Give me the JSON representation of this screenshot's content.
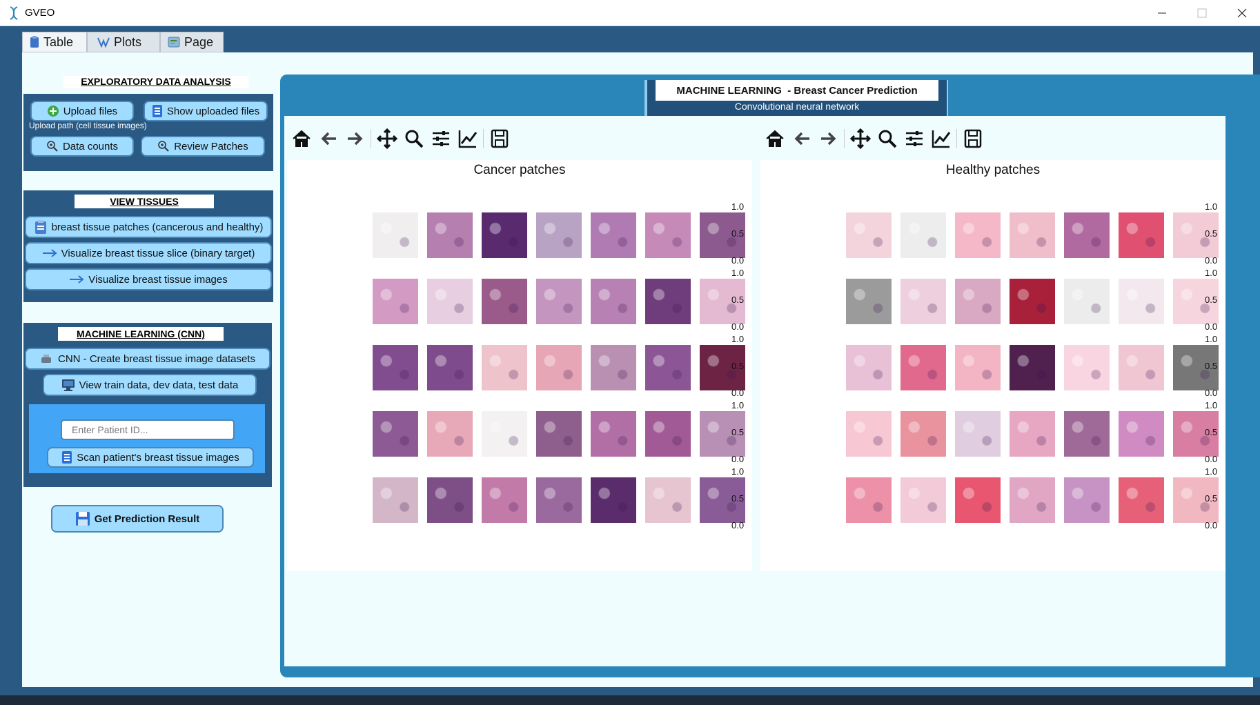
{
  "window": {
    "title": "GVEO"
  },
  "tabs": [
    {
      "label": "Table",
      "icon": "clipboard-icon"
    },
    {
      "label": "Plots",
      "icon": "plot-icon"
    },
    {
      "label": "Page",
      "icon": "page-icon"
    }
  ],
  "eda": {
    "title": "EXPLORATORY DATA ANALYSIS",
    "upload_label": "Upload files",
    "show_uploaded_label": "Show uploaded files",
    "upload_path_label": "Upload path (cell tissue images)",
    "data_counts_label": "Data counts",
    "review_patches_label": "Review Patches"
  },
  "view_tissues": {
    "title": "VIEW TISSUES",
    "patches_label": "breast tissue patches (cancerous and healthy)",
    "slice_label": "Visualize  breast tissue slice (binary target)",
    "images_label": "Visualize  breast tissue images"
  },
  "ml_cnn": {
    "title": "MACHINE LEARNING (CNN)",
    "create_label": "CNN - Create breast tissue image datasets",
    "view_label": "View train data, dev data, test data",
    "patient_placeholder": "Enter Patient ID...",
    "scan_label": "Scan patient's breast tissue images"
  },
  "prediction_label": "Get Prediction Result",
  "ml_panel": {
    "title": "MACHINE LEARNING  - Breast Cancer Prediction",
    "subtitle": "Convolutional neural network"
  },
  "figures": [
    {
      "title": "Cancer patches"
    },
    {
      "title": "Healthy patches"
    }
  ],
  "axis_ticks": [
    "1.0",
    "0.5",
    "0.0"
  ],
  "colors": {
    "panel_blue": "#2a85b8",
    "dark_blue": "#2a5a83",
    "button_fill": "#9fdcff",
    "content_bg": "#f0fdff"
  },
  "patch_tones": {
    "cancer": [
      [
        "#f1eef0",
        "#b57fb0",
        "#5a2a6e",
        "#b9a3c4",
        "#b07bb3",
        "#c58ab8",
        "#8c5a8e"
      ],
      [
        "#d39bc4",
        "#e7cfe1",
        "#9a5a8a",
        "#c496bf",
        "#b782b3",
        "#6f3d7b",
        "#e4b9d2"
      ],
      [
        "#824d8f",
        "#7e4b8c",
        "#efc3cb",
        "#e7a6b6",
        "#b98fb2",
        "#8c5696",
        "#6d2444"
      ],
      [
        "#8d5a95",
        "#e7a9b8",
        "#f3f1f2",
        "#8e5f8c",
        "#b26fa6",
        "#a15a95",
        "#b88fb5"
      ],
      [
        "#d3b7c9",
        "#7e4e86",
        "#c27aa9",
        "#9a6a9f",
        "#5a2c6c",
        "#e7c5d0",
        "#8a5c97"
      ]
    ],
    "healthy": [
      [
        "#f3d4dd",
        "#ededed",
        "#f4b8c8",
        "#f0bdcb",
        "#b16a9f",
        "#e05070",
        "#f2cbd6"
      ],
      [
        "#9b9b9b",
        "#edcfdd",
        "#d9a9c3",
        "#a8203a",
        "#ececec",
        "#f3e8ee",
        "#f7d5de"
      ],
      [
        "#e8c1d6",
        "#e2698e",
        "#f3b4c4",
        "#50204f",
        "#f9d5e1",
        "#f1c6d3",
        "#777777"
      ],
      [
        "#f7c8d4",
        "#e9939f",
        "#e0cde0",
        "#e7a7c3",
        "#a06a98",
        "#d08cc2",
        "#d77ea2"
      ],
      [
        "#ec91a8",
        "#f3cad8",
        "#e8566f",
        "#e2a6c5",
        "#c793c4",
        "#e66178",
        "#f1b8c1"
      ]
    ]
  }
}
